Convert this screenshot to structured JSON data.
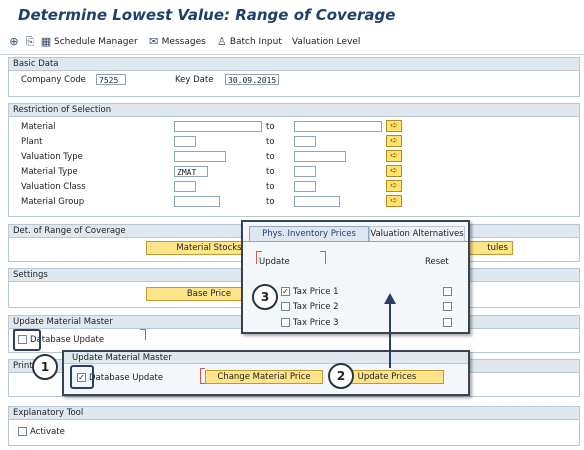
{
  "title": "Determine Lowest Value: Range of Coverage",
  "toolbar": {
    "items": [
      {
        "icon": "execute-icon"
      },
      {
        "icon": "get-variant-icon"
      },
      {
        "icon": "schedule-manager-icon",
        "label": "Schedule Manager"
      },
      {
        "icon": "messages-icon",
        "label": "Messages"
      },
      {
        "icon": "batch-input-icon",
        "label": "Batch Input"
      },
      {
        "label": "Valuation Level"
      }
    ]
  },
  "basic_data": {
    "header": "Basic Data",
    "company_code_label": "Company Code",
    "company_code_value": "7525",
    "key_date_label": "Key Date",
    "key_date_value": "30.09.2015"
  },
  "restriction": {
    "header": "Restriction of Selection",
    "to_label": "to",
    "rows": [
      {
        "label": "Material",
        "from": "",
        "to": ""
      },
      {
        "label": "Plant",
        "from": "",
        "to": ""
      },
      {
        "label": "Valuation Type",
        "from": "",
        "to": ""
      },
      {
        "label": "Material Type",
        "from": "ZMAT",
        "to": ""
      },
      {
        "label": "Valuation Class",
        "from": "",
        "to": ""
      },
      {
        "label": "Material Group",
        "from": "",
        "to": ""
      }
    ]
  },
  "det_range": {
    "header": "Det. of Range of Coverage",
    "material_stocks_label": "Material Stocks",
    "partial_button_label": "tules"
  },
  "settings": {
    "header": "Settings",
    "base_price_label": "Base Price"
  },
  "update_master": {
    "header": "Update Material Master",
    "database_update_label": "Database Update",
    "print_header_partial": "Print"
  },
  "explanatory": {
    "header": "Explanatory Tool",
    "activate_label": "Activate"
  },
  "popup_prices": {
    "tabs": [
      "Phys. Inventory Prices",
      "Valuation Alternatives"
    ],
    "update_col": "Update",
    "reset_col": "Reset",
    "rows": [
      {
        "label": "Tax Price 1",
        "checked": true
      },
      {
        "label": "Tax Price 2",
        "checked": false
      },
      {
        "label": "Tax Price 3",
        "checked": false
      }
    ]
  },
  "popup_update": {
    "header": "Update Material Master",
    "database_update_label": "Database Update",
    "database_update_checked": true,
    "change_price_label": "Change Material Price",
    "update_prices_label": "Update Prices"
  },
  "callouts": [
    "1",
    "2",
    "3"
  ],
  "colors": {
    "title": "#1f3f6e",
    "group_header": "#dfe7ef",
    "button_yellow": "#ffe58a",
    "callout_border": "#2b3440",
    "bracket_red": "#d9534f"
  }
}
